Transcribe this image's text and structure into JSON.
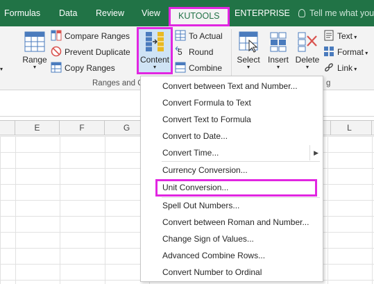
{
  "colors": {
    "excel_green": "#217346",
    "highlight_magenta": "#e126e1",
    "ribbon_bg": "#f3f3f3"
  },
  "menubar": {
    "tabs": [
      {
        "label": "Formulas"
      },
      {
        "label": "Data"
      },
      {
        "label": "Review"
      },
      {
        "label": "View"
      },
      {
        "label": "KUTOOLS",
        "active": true
      },
      {
        "label": "ENTERPRISE"
      }
    ],
    "tell_me": "Tell me what you"
  },
  "ribbon": {
    "range_label": "Range",
    "compare_ranges": "Compare Ranges",
    "prevent_duplicate": "Prevent Duplicate",
    "copy_ranges": "Copy Ranges",
    "content_label": "Content",
    "to_actual": "To Actual",
    "round": "Round",
    "combine": "Combine",
    "group_label": "Ranges and C",
    "group_label_tail": "g",
    "select_label": "Select",
    "insert_label": "Insert",
    "delete_label": "Delete",
    "text_label": "Text",
    "format_label": "Format",
    "link_label": "Link",
    "icons": {
      "range": "range-icon",
      "compare": "compare-ranges-icon",
      "prevent": "prevent-duplicate-icon",
      "copy": "copy-ranges-icon",
      "content": "content-icon",
      "to_actual": "to-actual-icon",
      "round": "round-icon",
      "combine": "combine-icon",
      "select": "select-icon",
      "insert": "insert-icon",
      "delete": "delete-icon",
      "text": "text-icon",
      "format": "format-icon",
      "link": "link-icon"
    }
  },
  "columns": [
    "E",
    "F",
    "G",
    "L"
  ],
  "dropdown": {
    "items": [
      {
        "label": "Convert between Text and Number..."
      },
      {
        "label": "Convert Formula to Text"
      },
      {
        "label": "Convert Text to Formula"
      },
      {
        "label": "Convert to Date..."
      },
      {
        "label": "Convert Time...",
        "submenu": true
      },
      {
        "label": "Currency Conversion..."
      },
      {
        "label": "Unit Conversion...",
        "highlighted": true
      },
      {
        "label": "Spell Out Numbers..."
      },
      {
        "label": "Convert between Roman and Number..."
      },
      {
        "label": "Change Sign of Values..."
      },
      {
        "label": "Advanced Combine Rows..."
      },
      {
        "label": "Convert Number to Ordinal"
      }
    ]
  }
}
